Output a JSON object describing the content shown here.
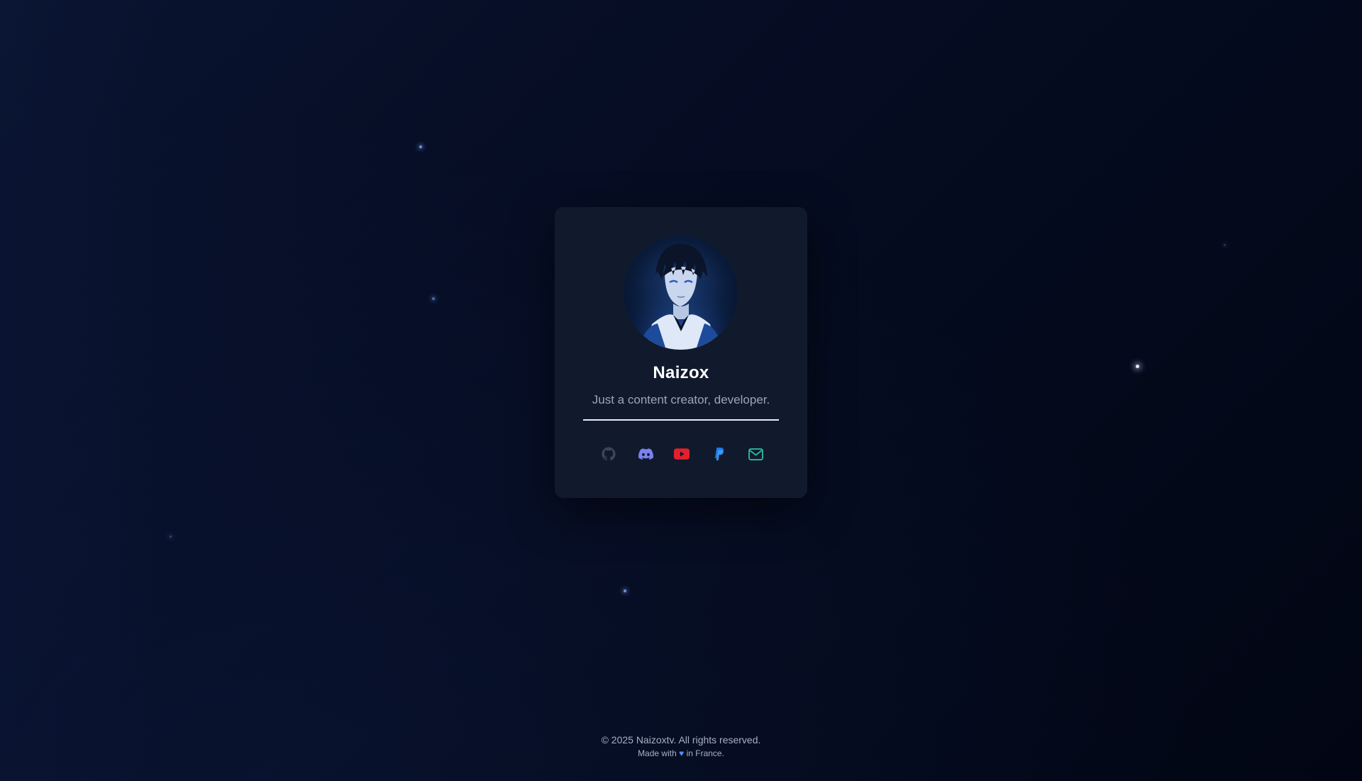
{
  "profile": {
    "name": "Naizox",
    "tagline": "Just a content creator, developer."
  },
  "socials": [
    {
      "icon": "github-icon",
      "color": "#4a5468"
    },
    {
      "icon": "discord-icon",
      "color": "#7b82f0"
    },
    {
      "icon": "youtube-icon",
      "color": "#e5202b"
    },
    {
      "icon": "paypal-icon",
      "color": "#1f77e0"
    },
    {
      "icon": "mail-icon",
      "color": "#2ab7a0"
    }
  ],
  "footer": {
    "copyright": "© 2025 Naizoxtv. All rights reserved.",
    "made_prefix": "Made with",
    "heart": "♥",
    "made_suffix": "in France."
  },
  "colors": {
    "background": "#050b1f",
    "card": "#111a2c",
    "accent": "#5b8cff"
  }
}
